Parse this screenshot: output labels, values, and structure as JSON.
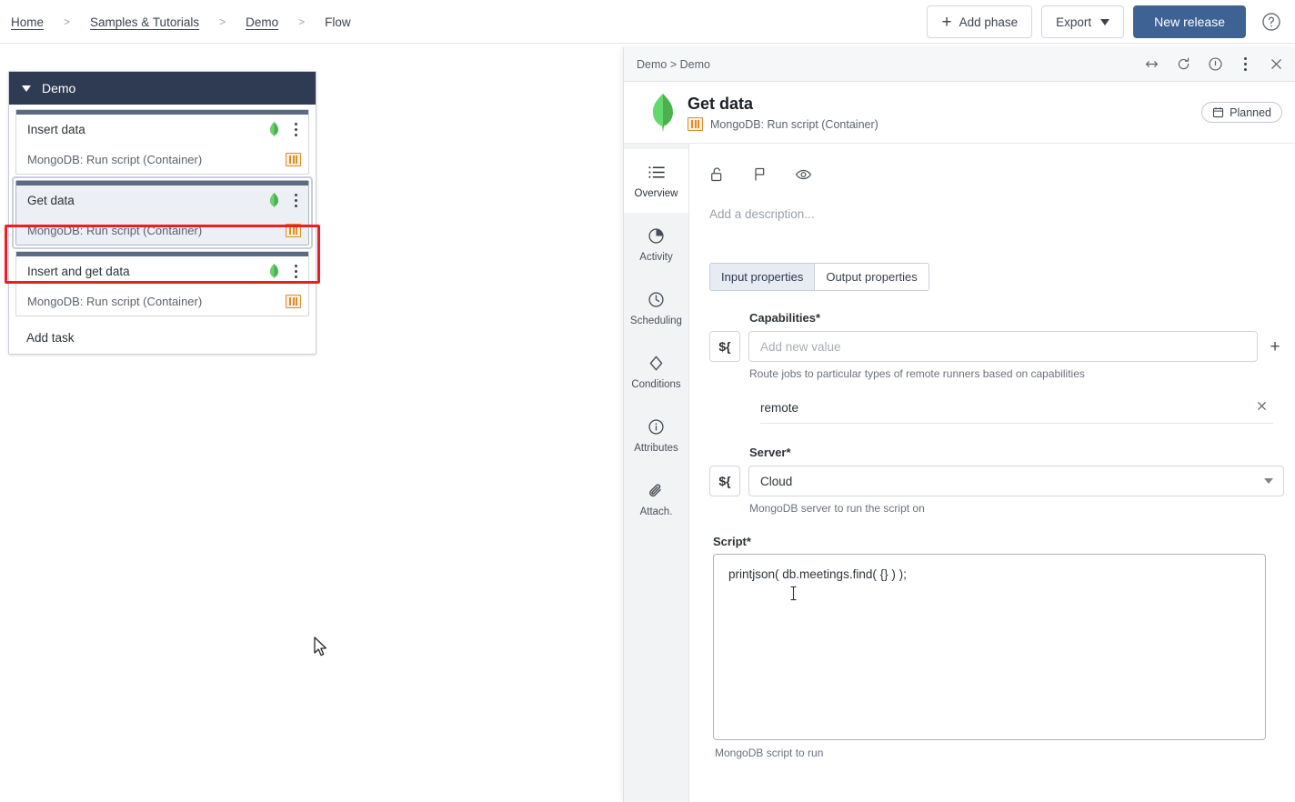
{
  "breadcrumb": {
    "items": [
      {
        "label": "Home",
        "link": true
      },
      {
        "label": "Samples & Tutorials",
        "link": true
      },
      {
        "label": "Demo",
        "link": true
      },
      {
        "label": "Flow",
        "link": false
      }
    ],
    "separator": ">"
  },
  "toolbar": {
    "add_phase_label": "Add phase",
    "add_phase_icon": "plus-icon",
    "export_label": "Export",
    "export_icon": "chevron-down-icon",
    "new_release_label": "New release",
    "help_icon": "help-circle-icon",
    "primary_color": "#3d6293"
  },
  "canvas": {
    "phase": {
      "title": "Demo",
      "collapse_icon": "triangle-down-icon",
      "add_task_label": "Add task",
      "tasks": [
        {
          "title": "Insert data",
          "subtitle": "MongoDB: Run script (Container)",
          "status_icon": "mongodb-leaf-icon",
          "menu_icon": "kebab-menu-icon",
          "type_icon": "container-icon",
          "selected": false
        },
        {
          "title": "Get data",
          "subtitle": "MongoDB: Run script (Container)",
          "status_icon": "mongodb-leaf-icon",
          "menu_icon": "kebab-menu-icon",
          "type_icon": "container-icon",
          "selected": true
        },
        {
          "title": "Insert and get data",
          "subtitle": "MongoDB: Run script (Container)",
          "status_icon": "mongodb-leaf-icon",
          "menu_icon": "kebab-menu-icon",
          "type_icon": "container-icon",
          "selected": false
        }
      ]
    },
    "highlight_color": "#ee1c25"
  },
  "panel": {
    "breadcrumb": "Demo > Demo",
    "window_icons": [
      "expand-horizontal-icon",
      "refresh-icon",
      "info-icon",
      "kebab-menu-icon",
      "close-icon"
    ],
    "header": {
      "logo_icon": "mongodb-leaf-icon",
      "title": "Get data",
      "type_icon": "container-icon",
      "subtitle": "MongoDB: Run script (Container)",
      "status_badge": "Planned",
      "status_badge_icon": "calendar-icon"
    },
    "nav": [
      {
        "label": "Overview",
        "icon": "list-icon",
        "active": true
      },
      {
        "label": "Activity",
        "icon": "pie-chart-icon",
        "active": false
      },
      {
        "label": "Scheduling",
        "icon": "clock-icon",
        "active": false
      },
      {
        "label": "Conditions",
        "icon": "diamond-icon",
        "active": false
      },
      {
        "label": "Attributes",
        "icon": "info-circle-icon",
        "active": false
      },
      {
        "label": "Attach.",
        "icon": "paperclip-icon",
        "active": false
      }
    ],
    "action_icons": [
      "unlock-icon",
      "flag-icon",
      "eye-icon"
    ],
    "description_placeholder": "Add a description...",
    "tabs": [
      {
        "label": "Input properties",
        "active": true
      },
      {
        "label": "Output properties",
        "active": false
      }
    ],
    "fields": {
      "capabilities": {
        "label": "Capabilities",
        "required_marker": "*",
        "variable_button": "${",
        "placeholder": "Add new value",
        "value": "",
        "add_icon": "plus-icon",
        "helper": "Route jobs to particular types of remote runners based on capabilities",
        "chips": [
          {
            "label": "remote",
            "remove_icon": "close-icon"
          }
        ]
      },
      "server": {
        "label": "Server",
        "required_marker": "*",
        "variable_button": "${",
        "value": "Cloud",
        "dropdown_icon": "chevron-down-icon",
        "helper": "MongoDB server to run the script on"
      },
      "script": {
        "label": "Script",
        "required_marker": "*",
        "value": "printjson( db.meetings.find( {} ) );",
        "helper": "MongoDB script to run"
      }
    }
  }
}
